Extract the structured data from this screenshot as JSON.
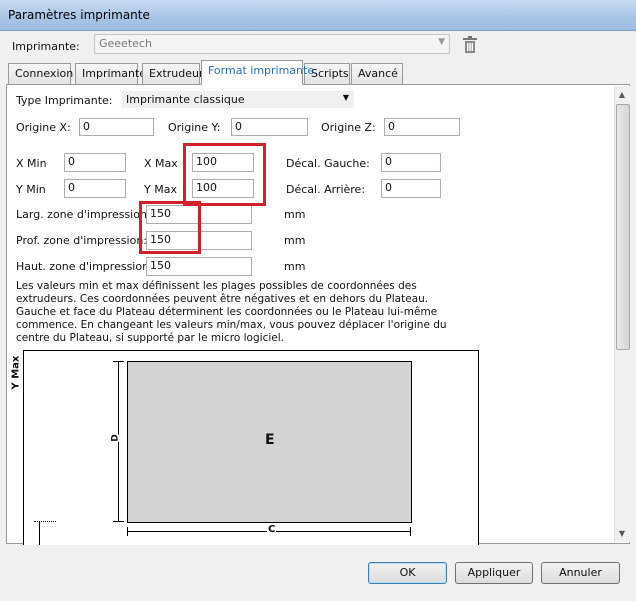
{
  "window": {
    "title": "Paramètres imprimante"
  },
  "printer": {
    "label": "Imprimante:",
    "value": "Geeetech"
  },
  "tabs": [
    {
      "label": "Connexion"
    },
    {
      "label": "Imprimante"
    },
    {
      "label": "Extrudeur"
    },
    {
      "label": "Format imprimante"
    },
    {
      "label": "Scripts"
    },
    {
      "label": "Avancé"
    }
  ],
  "active_tab": "Format imprimante",
  "form": {
    "printer_type_label": "Type Imprimante:",
    "printer_type_value": "Imprimante classique",
    "origin_x_label": "Origine X:",
    "origin_x": "0",
    "origin_y_label": "Origine Y:",
    "origin_y": "0",
    "origin_z_label": "Origine Z:",
    "origin_z": "0",
    "xmin_label": "X Min",
    "xmin": "0",
    "xmax_label": "X Max",
    "xmax": "100",
    "offset_left_label": "Décal. Gauche:",
    "offset_left": "0",
    "ymin_label": "Y Min",
    "ymin": "0",
    "ymax_label": "Y Max",
    "ymax": "100",
    "offset_back_label": "Décal. Arrière:",
    "offset_back": "0",
    "width_label": "Larg. zone d'impression:",
    "width": "150",
    "width_unit": "mm",
    "depth_label": "Prof. zone d'impression:",
    "depth": "150",
    "depth_unit": "mm",
    "height_label": "Haut. zone d'impression:",
    "height": "150",
    "height_unit": "mm"
  },
  "description": "Les valeurs min et max définissent les plages possibles de coordonnées des extrudeurs. Ces coordonnées peuvent être négatives et en dehors du Plateau. Gauche et face du Plateau déterminent les coordonnées ou le Plateau lui-même commence. En changeant les valeurs min/max, vous pouvez déplacer l'origine du centre du Plateau, si supporté par le micro logiciel.",
  "diagram": {
    "ymax_label": "Y Max",
    "plate_label": "E",
    "depth_label": "D",
    "width_label": "C"
  },
  "buttons": {
    "ok": "OK",
    "apply": "Appliquer",
    "cancel": "Annuler"
  }
}
